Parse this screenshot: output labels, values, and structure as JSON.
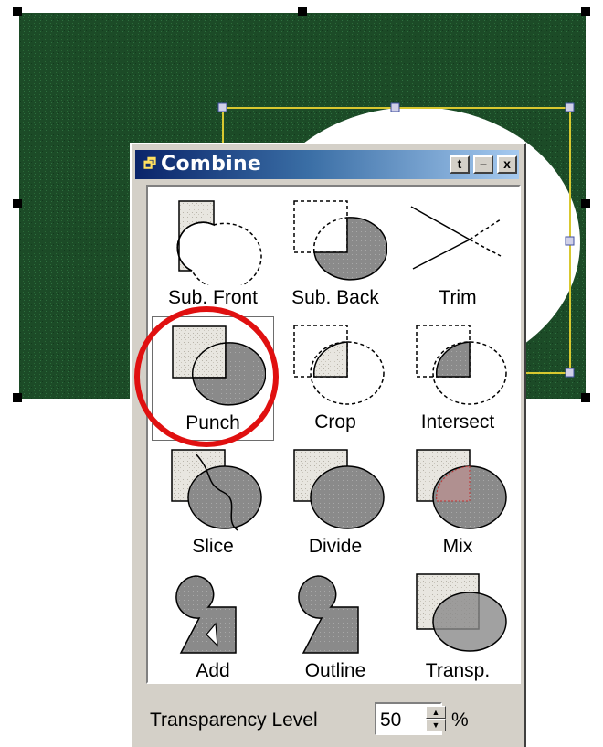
{
  "panel": {
    "title": "Combine",
    "title_icon": "combine-app-icon",
    "buttons": [
      {
        "name": "pin-button",
        "glyph": "t"
      },
      {
        "name": "minimize-button",
        "glyph": "–"
      },
      {
        "name": "close-button",
        "glyph": "x"
      }
    ]
  },
  "tools": [
    {
      "key": "sub-front",
      "label": "Sub. Front"
    },
    {
      "key": "sub-back",
      "label": "Sub. Back"
    },
    {
      "key": "trim",
      "label": "Trim"
    },
    {
      "key": "punch",
      "label": "Punch",
      "selected": true
    },
    {
      "key": "crop",
      "label": "Crop"
    },
    {
      "key": "intersect",
      "label": "Intersect"
    },
    {
      "key": "slice",
      "label": "Slice"
    },
    {
      "key": "divide",
      "label": "Divide"
    },
    {
      "key": "mix",
      "label": "Mix"
    },
    {
      "key": "add",
      "label": "Add"
    },
    {
      "key": "outline",
      "label": "Outline"
    },
    {
      "key": "transp",
      "label": "Transp."
    }
  ],
  "transparency": {
    "label": "Transparency Level",
    "value": "50",
    "unit": "%"
  },
  "colors": {
    "canvas_green": "#1a4a26",
    "selection_yellow": "#d8c830",
    "annotation_red": "#e01010",
    "shape_gray": "#8a8a8a"
  }
}
